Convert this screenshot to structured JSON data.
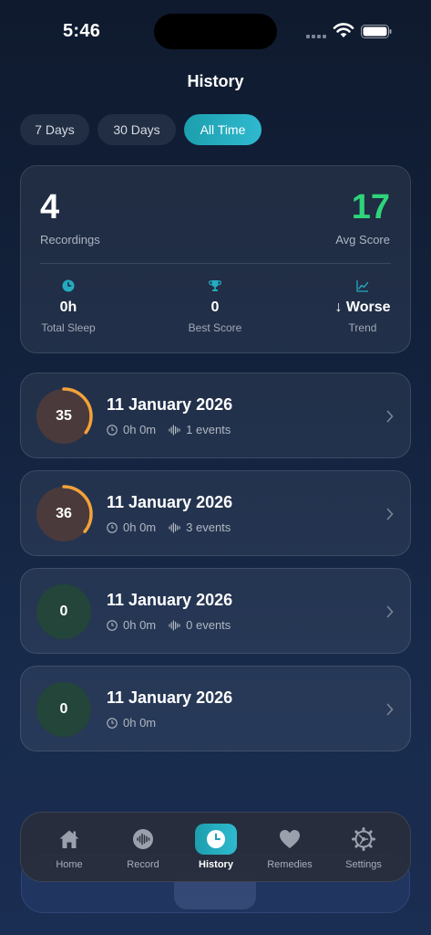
{
  "status_bar": {
    "time": "5:46"
  },
  "page": {
    "title": "History"
  },
  "filters": [
    {
      "label": "7 Days",
      "active": false
    },
    {
      "label": "30 Days",
      "active": false
    },
    {
      "label": "All Time",
      "active": true
    }
  ],
  "summary": {
    "recordings_value": "4",
    "recordings_label": "Recordings",
    "avg_score_value": "17",
    "avg_score_label": "Avg Score",
    "total_sleep_value": "0h",
    "total_sleep_label": "Total Sleep",
    "best_score_value": "0",
    "best_score_label": "Best Score",
    "trend_value": "↓ Worse",
    "trend_label": "Trend"
  },
  "recordings": [
    {
      "score": "35",
      "score_pct": 35,
      "date": "11 January 2026",
      "duration": "0h 0m",
      "events": "1 events"
    },
    {
      "score": "36",
      "score_pct": 36,
      "date": "11 January 2026",
      "duration": "0h 0m",
      "events": "3 events"
    },
    {
      "score": "0",
      "score_pct": 0,
      "date": "11 January 2026",
      "duration": "0h 0m",
      "events": "0 events"
    },
    {
      "score": "0",
      "score_pct": 0,
      "date": "11 January 2026",
      "duration": "0h 0m",
      "events": ""
    }
  ],
  "tabs": [
    {
      "label": "Home",
      "icon": "home-icon"
    },
    {
      "label": "Record",
      "icon": "waveform-icon"
    },
    {
      "label": "History",
      "icon": "clock-icon",
      "active": true
    },
    {
      "label": "Remedies",
      "icon": "heart-icon"
    },
    {
      "label": "Settings",
      "icon": "gear-icon"
    }
  ],
  "colors": {
    "accent": "#25abc0",
    "good_score": "#2ed47a",
    "ring_orange": "#f4a23a",
    "ring_bg_warm": "#4a3a3c",
    "ring_bg_green": "#23453a"
  }
}
